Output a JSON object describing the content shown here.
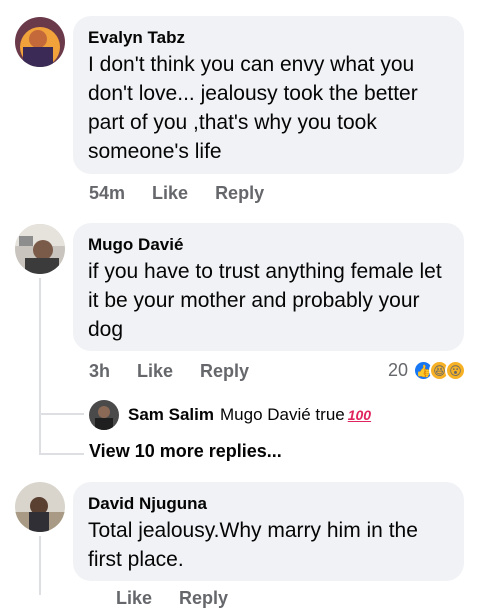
{
  "comments": [
    {
      "author": "Evalyn Tabz",
      "text": "I don't think you can envy what you don't love... jealousy took the better part of you ,that's why you took someone's life",
      "time": "54m",
      "like_label": "Like",
      "reply_label": "Reply"
    },
    {
      "author": "Mugo Davié",
      "text": "if you have to trust anything female let it be your mother and probably your dog",
      "time": "3h",
      "like_label": "Like",
      "reply_label": "Reply",
      "reaction_count": "20",
      "reaction_icons": [
        "like-icon",
        "haha-icon",
        "wow-icon"
      ],
      "reply": {
        "author": "Sam Salim",
        "text": "Mugo Davié true",
        "emoji": "100"
      },
      "more_replies": "View 10 more replies..."
    },
    {
      "author": "David Njuguna",
      "text": "Total jealousy.Why marry him in the first place.",
      "time": "",
      "like_label": "Like",
      "reply_label": "Reply"
    }
  ],
  "colors": {
    "bubble": "#f0f2f5",
    "meta": "#65676b",
    "like_blue": "#1877f2",
    "emoji_yellow": "#f7b125"
  }
}
